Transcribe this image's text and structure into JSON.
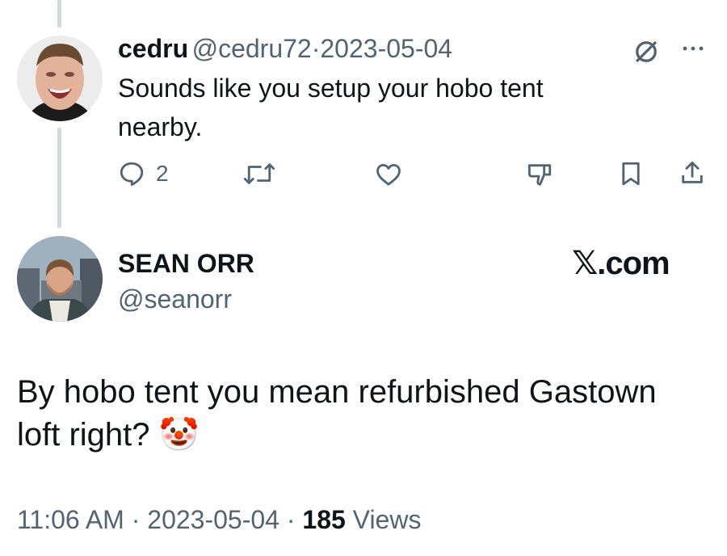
{
  "reply": {
    "display_name": "cedru",
    "handle": "@cedru72",
    "separator": "·",
    "date": "2023-05-04",
    "text_line1": "Sounds like you setup your hobo tent",
    "text_line2": "nearby.",
    "reply_count": "2",
    "icons": [
      "reply-icon",
      "retweet-icon",
      "like-icon",
      "dislike-icon",
      "bookmark-icon",
      "share-icon",
      "grok-icon",
      "more-icon"
    ]
  },
  "main": {
    "display_name": "SEAN ORR",
    "handle": "@seanorr",
    "watermark": "𝕏.com",
    "text_line1": "By hobo tent you mean refurbished Gastown",
    "text_line2": "loft right?",
    "emoji": "🤡",
    "time": "11:06 AM",
    "separator": "·",
    "date": "2023-05-04",
    "views_count": "185",
    "views_label": "Views"
  },
  "colors": {
    "text": "#0f1419",
    "muted": "#536471",
    "thread": "#cfd9de"
  }
}
